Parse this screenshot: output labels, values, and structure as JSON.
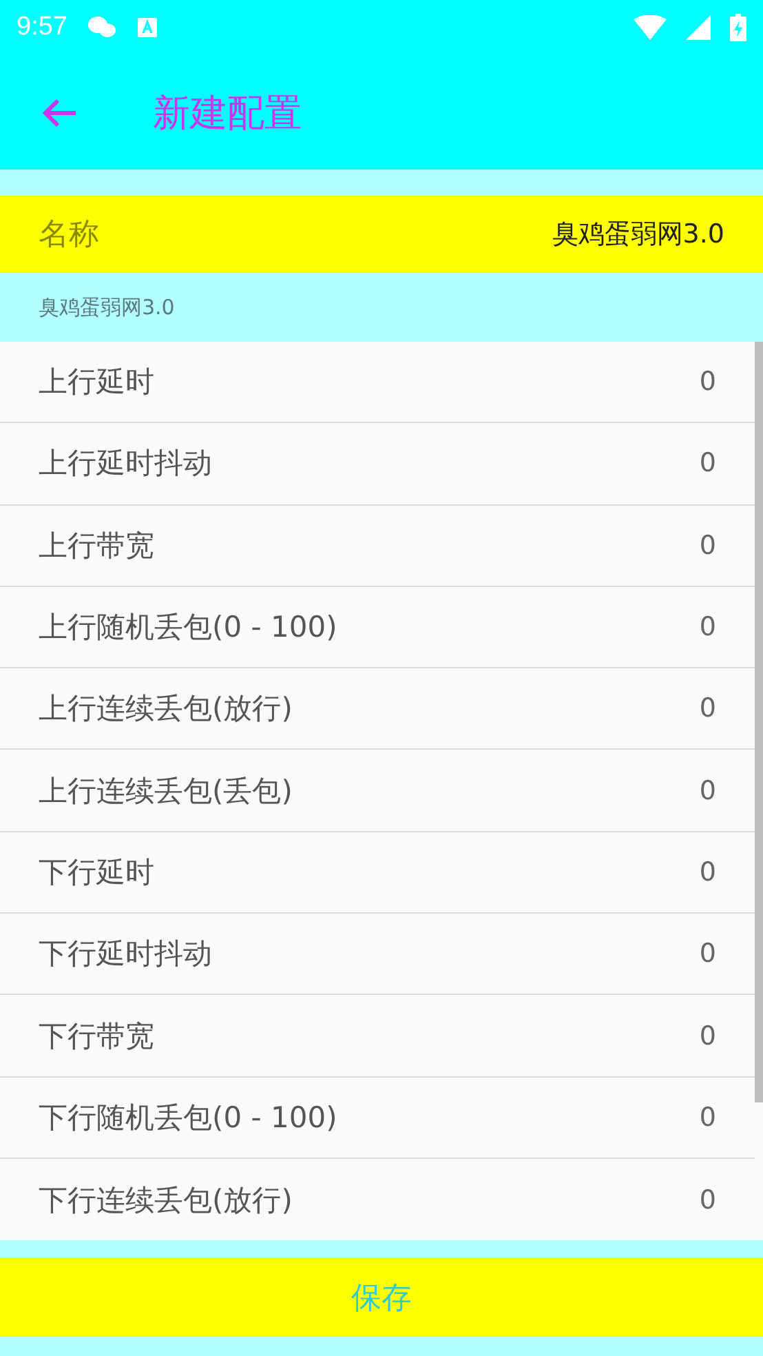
{
  "status_bar": {
    "time": "9:57"
  },
  "toolbar": {
    "title": "新建配置"
  },
  "name_field": {
    "label": "名称",
    "value": "臭鸡蛋弱网3.0"
  },
  "subtitle": "臭鸡蛋弱网3.0",
  "settings": [
    {
      "label": "上行延时",
      "value": "0"
    },
    {
      "label": "上行延时抖动",
      "value": "0"
    },
    {
      "label": "上行带宽",
      "value": "0"
    },
    {
      "label": "上行随机丢包(0 - 100)",
      "value": "0"
    },
    {
      "label": "上行连续丢包(放行)",
      "value": "0"
    },
    {
      "label": "上行连续丢包(丢包)",
      "value": "0"
    },
    {
      "label": "下行延时",
      "value": "0"
    },
    {
      "label": "下行延时抖动",
      "value": "0"
    },
    {
      "label": "下行带宽",
      "value": "0"
    },
    {
      "label": "下行随机丢包(0 - 100)",
      "value": "0"
    },
    {
      "label": "下行连续丢包(放行)",
      "value": "0"
    }
  ],
  "save_button": "保存"
}
